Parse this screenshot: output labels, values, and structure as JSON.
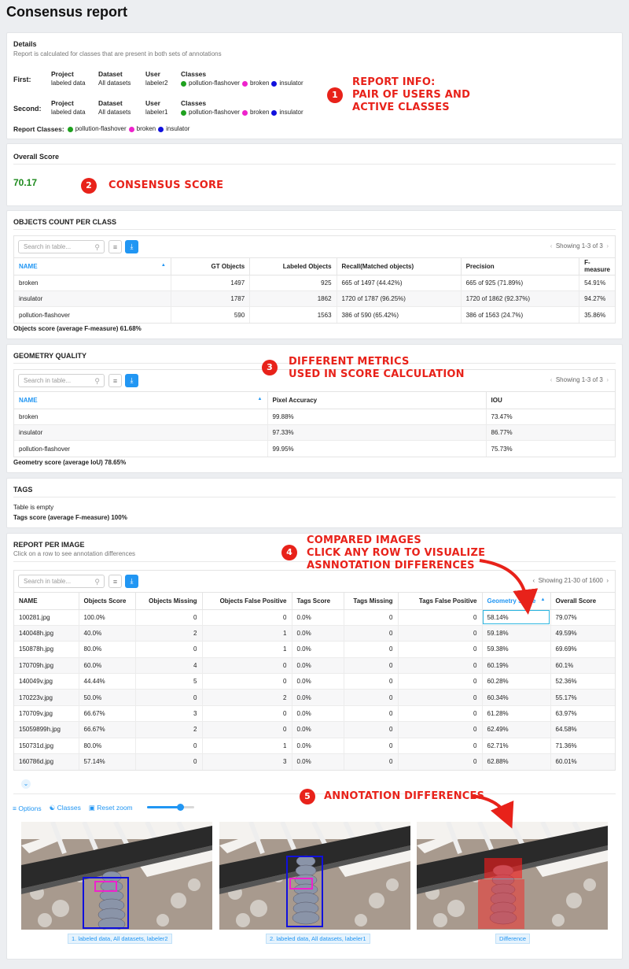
{
  "page": {
    "title": "Consensus report"
  },
  "details": {
    "title": "Details",
    "subtitle": "Report is calculated for classes that are present in both sets of annotations",
    "column_labels": {
      "project": "Project",
      "dataset": "Dataset",
      "user": "User",
      "classes": "Classes"
    },
    "first": {
      "label": "First:",
      "project": "labeled data",
      "dataset": "All datasets",
      "user": "labeler2"
    },
    "second": {
      "label": "Second:",
      "project": "labeled data",
      "dataset": "All datasets",
      "user": "labeler1"
    },
    "report_classes_label": "Report Classes:",
    "classes": [
      {
        "name": "pollution-flashover",
        "color": "#1fa11f"
      },
      {
        "name": "broken",
        "color": "#ee22cc"
      },
      {
        "name": "insulator",
        "color": "#1010dd"
      }
    ]
  },
  "overall": {
    "title": "Overall Score",
    "score": "70.17"
  },
  "objects_count": {
    "title": "OBJECTS COUNT PER CLASS",
    "search_placeholder": "Search in table...",
    "pager": "Showing 1-3 of 3",
    "columns": [
      "NAME",
      "GT Objects",
      "Labeled Objects",
      "Recall(Matched objects)",
      "Precision",
      "F-measure"
    ],
    "rows": [
      [
        "broken",
        "1497",
        "925",
        "665 of 1497 (44.42%)",
        "665 of 925 (71.89%)",
        "54.91%"
      ],
      [
        "insulator",
        "1787",
        "1862",
        "1720 of 1787 (96.25%)",
        "1720 of 1862 (92.37%)",
        "94.27%"
      ],
      [
        "pollution-flashover",
        "590",
        "1563",
        "386 of 590 (65.42%)",
        "386 of 1563 (24.7%)",
        "35.86%"
      ]
    ],
    "footer": "Objects score (average F-measure) 61.68%"
  },
  "geometry": {
    "title": "GEOMETRY QUALITY",
    "search_placeholder": "Search in table...",
    "pager": "Showing 1-3 of 3",
    "columns": [
      "NAME",
      "Pixel Accuracy",
      "IOU"
    ],
    "rows": [
      [
        "broken",
        "99.88%",
        "73.47%"
      ],
      [
        "insulator",
        "97.33%",
        "86.77%"
      ],
      [
        "pollution-flashover",
        "99.95%",
        "75.73%"
      ]
    ],
    "footer": "Geometry score (average IoU) 78.65%"
  },
  "tags": {
    "title": "TAGS",
    "empty": "Table is empty",
    "footer": "Tags score (average F-measure) 100%"
  },
  "per_image": {
    "title": "REPORT PER IMAGE",
    "subtitle": "Click on a row to see annotation differences",
    "search_placeholder": "Search in table...",
    "pager": "Showing 21-30 of 1600",
    "columns": [
      "NAME",
      "Objects Score",
      "Objects Missing",
      "Objects False Positive",
      "Tags Score",
      "Tags Missing",
      "Tags False Positive",
      "Geometry Score",
      "Overall Score"
    ],
    "rows": [
      [
        "100281.jpg",
        "100.0%",
        "0",
        "0",
        "0.0%",
        "0",
        "0",
        "58.14%",
        "79.07%"
      ],
      [
        "140048h.jpg",
        "40.0%",
        "2",
        "1",
        "0.0%",
        "0",
        "0",
        "59.18%",
        "49.59%"
      ],
      [
        "150878h.jpg",
        "80.0%",
        "0",
        "1",
        "0.0%",
        "0",
        "0",
        "59.38%",
        "69.69%"
      ],
      [
        "170709h.jpg",
        "60.0%",
        "4",
        "0",
        "0.0%",
        "0",
        "0",
        "60.19%",
        "60.1%"
      ],
      [
        "140049v.jpg",
        "44.44%",
        "5",
        "0",
        "0.0%",
        "0",
        "0",
        "60.28%",
        "52.36%"
      ],
      [
        "170223v.jpg",
        "50.0%",
        "0",
        "2",
        "0.0%",
        "0",
        "0",
        "60.34%",
        "55.17%"
      ],
      [
        "170709v.jpg",
        "66.67%",
        "3",
        "0",
        "0.0%",
        "0",
        "0",
        "61.28%",
        "63.97%"
      ],
      [
        "15059899h.jpg",
        "66.67%",
        "2",
        "0",
        "0.0%",
        "0",
        "0",
        "62.49%",
        "64.58%"
      ],
      [
        "150731d.jpg",
        "80.0%",
        "0",
        "1",
        "0.0%",
        "0",
        "0",
        "62.71%",
        "71.36%"
      ],
      [
        "160786d.jpg",
        "57.14%",
        "0",
        "3",
        "0.0%",
        "0",
        "0",
        "62.88%",
        "60.01%"
      ]
    ]
  },
  "viewer": {
    "options_label": "Options",
    "classes_label": "Classes",
    "reset_zoom_label": "Reset zoom",
    "zoom_level": 0.7,
    "captions": [
      "1. labeled data, All datasets, labeler2",
      "2. labeled data, All datasets, labeler1",
      "Difference"
    ]
  },
  "annotations": {
    "a1": {
      "num": "1",
      "text": "REPORT INFO:\nPAIR OF USERS AND\nACTIVE CLASSES"
    },
    "a2": {
      "num": "2",
      "text": "CONSENSUS SCORE"
    },
    "a3": {
      "num": "3",
      "text": "DIFFERENT METRICS\nUSED IN SCORE CALCULATION"
    },
    "a4": {
      "num": "4",
      "text": "COMPARED IMAGES\nCLICK ANY ROW TO VISUALIZE\nASNNOTATION DIFFERENCES"
    },
    "a5": {
      "num": "5",
      "text": "ANNOTATION DIFFERENCES"
    }
  }
}
